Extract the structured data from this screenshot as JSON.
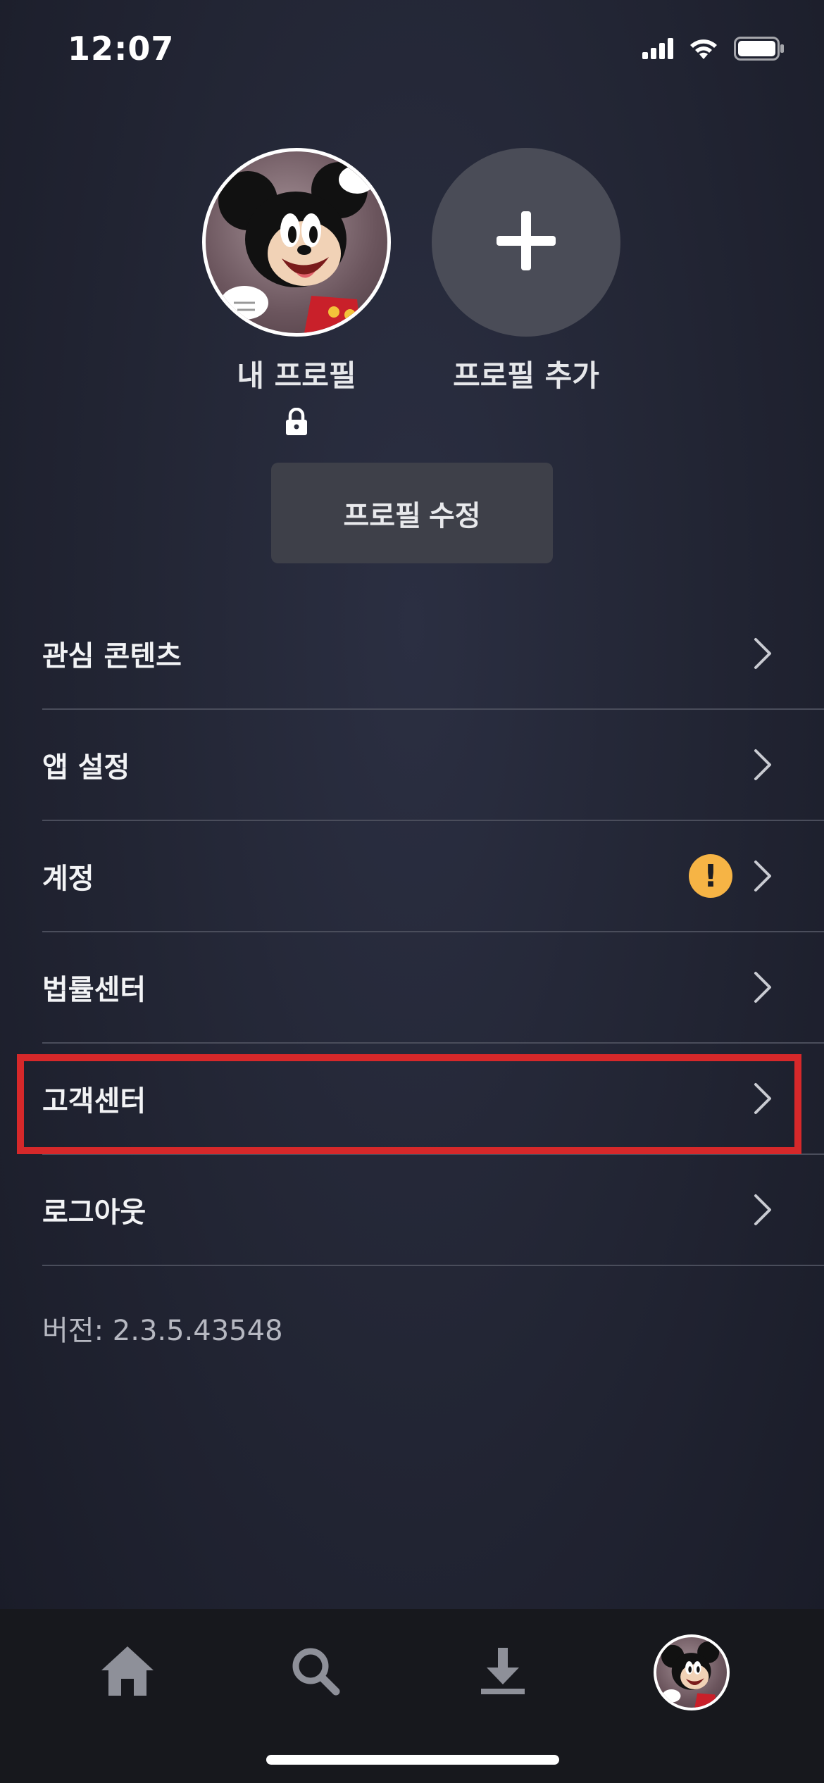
{
  "status_bar": {
    "time": "12:07",
    "icons": [
      "cellular-signal-icon",
      "wifi-icon",
      "battery-icon"
    ]
  },
  "profiles": [
    {
      "name": "내 프로필",
      "icon": "mickey-avatar",
      "locked": true
    },
    {
      "name": "프로필 추가",
      "icon": "plus-icon"
    }
  ],
  "edit_profile_label": "프로필 수정",
  "menu": {
    "items": [
      {
        "label": "관심 콘텐츠"
      },
      {
        "label": "앱 설정"
      },
      {
        "label": "계정",
        "badge": "!"
      },
      {
        "label": "법률센터"
      },
      {
        "label": "고객센터"
      },
      {
        "label": "로그아웃"
      }
    ]
  },
  "version": "버전: 2.3.5.43548",
  "bottom_nav": {
    "items": [
      "home-icon",
      "search-icon",
      "download-icon",
      "profile-avatar"
    ]
  },
  "colors": {
    "background": "#1a1d29",
    "warning_badge": "#f6b445",
    "highlight": "#d6282a",
    "button": "#3e4049"
  }
}
